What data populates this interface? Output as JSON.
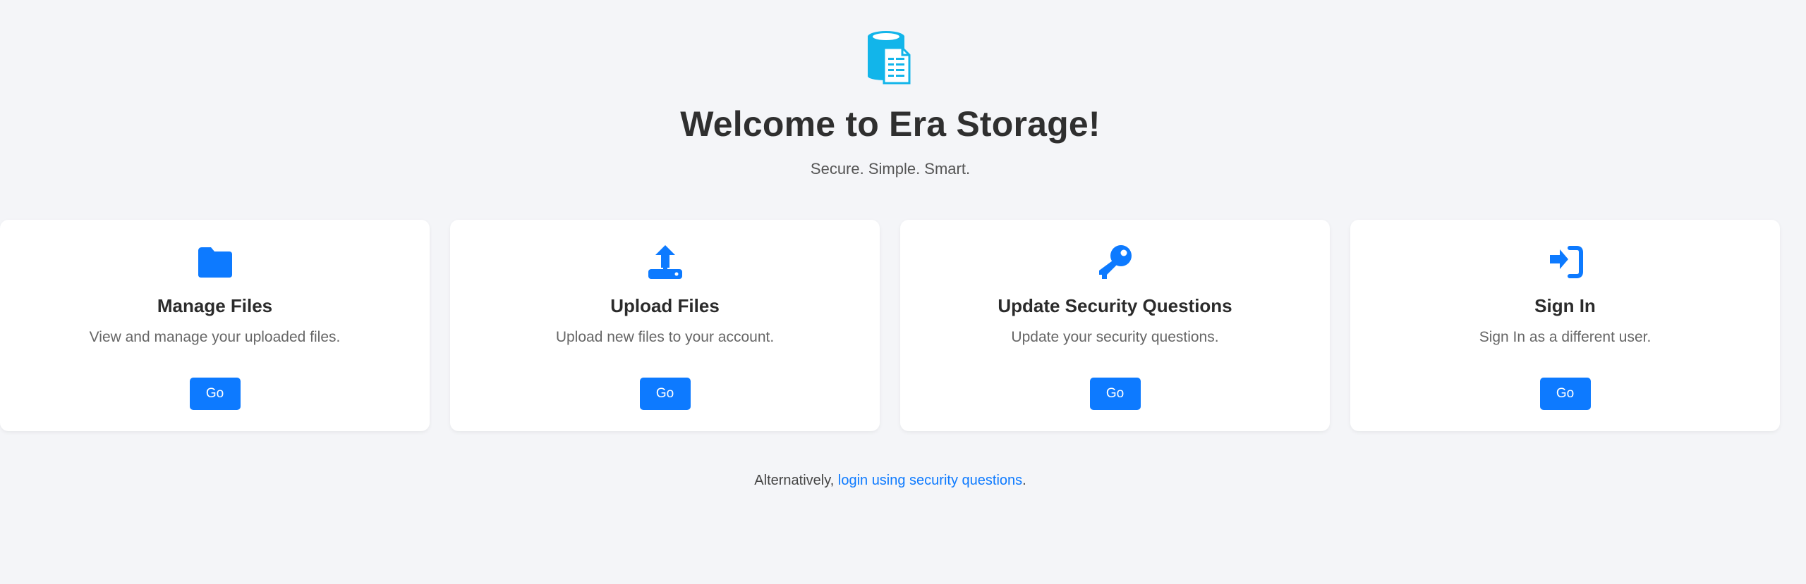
{
  "header": {
    "logo_icon": "database-document-icon",
    "title": "Welcome to Era Storage!",
    "subtitle": "Secure. Simple. Smart."
  },
  "cards": [
    {
      "icon": "folder-icon",
      "title": "Manage Files",
      "description": "View and manage your uploaded files.",
      "button": "Go"
    },
    {
      "icon": "upload-icon",
      "title": "Upload Files",
      "description": "Upload new files to your account.",
      "button": "Go"
    },
    {
      "icon": "key-icon",
      "title": "Update Security Questions",
      "description": "Update your security questions.",
      "button": "Go"
    },
    {
      "icon": "sign-in-icon",
      "title": "Sign In",
      "description": "Sign In as a different user.",
      "button": "Go"
    }
  ],
  "footer": {
    "prefix": "Alternatively, ",
    "link_text": "login using security questions",
    "suffix": "."
  },
  "colors": {
    "accent": "#0d7aff",
    "logo": "#12b5ea",
    "background": "#f4f5f8"
  }
}
